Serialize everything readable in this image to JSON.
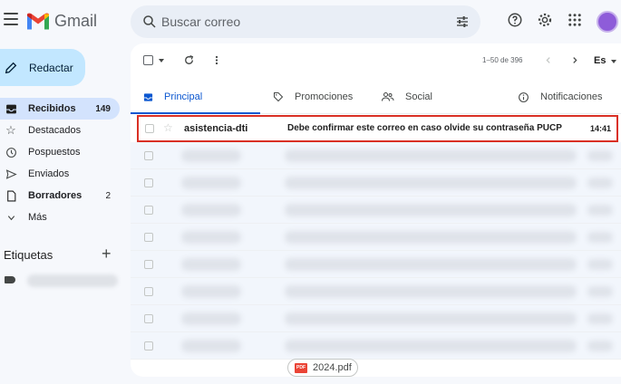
{
  "app": {
    "name": "Gmail"
  },
  "search": {
    "placeholder": "Buscar correo"
  },
  "sidebar": {
    "compose_label": "Redactar",
    "items": [
      {
        "label": "Recibidos",
        "count": "149"
      },
      {
        "label": "Destacados",
        "count": ""
      },
      {
        "label": "Pospuestos",
        "count": ""
      },
      {
        "label": "Enviados",
        "count": ""
      },
      {
        "label": "Borradores",
        "count": "2"
      },
      {
        "label": "Más",
        "count": ""
      }
    ],
    "labels_title": "Etiquetas",
    "labels_add": "+"
  },
  "toolbar": {
    "page_info": "1–50 de 396",
    "lang": "Es"
  },
  "tabs": [
    {
      "label": "Principal",
      "icon": "inbox-icon"
    },
    {
      "label": "Promociones",
      "icon": "tag-icon"
    },
    {
      "label": "Social",
      "icon": "people-icon"
    },
    {
      "label": "Notificaciones",
      "icon": "info-icon"
    }
  ],
  "emails": [
    {
      "sender": "asistencia-dti",
      "subject": "Debe confirmar este correo en caso olvide su contraseña PUCP",
      "time": "14:41"
    }
  ],
  "attachment": {
    "name": "2024.pdf",
    "badge": "PDF"
  },
  "colors": {
    "accent": "#0b57d0",
    "compose": "#c2e7ff",
    "highlight": "#d93025",
    "active_nav": "#d3e3fd"
  }
}
